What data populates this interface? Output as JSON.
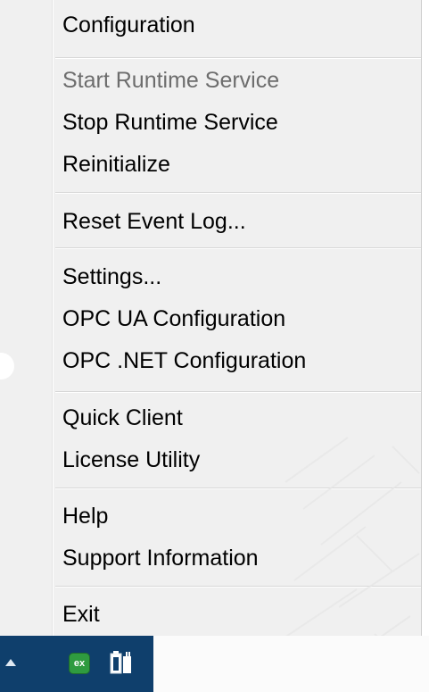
{
  "menu": {
    "items": [
      {
        "label": "Configuration",
        "enabled": true
      },
      {
        "label": "Start Runtime Service",
        "enabled": false
      },
      {
        "label": "Stop Runtime Service",
        "enabled": true
      },
      {
        "label": "Reinitialize",
        "enabled": true
      },
      {
        "label": "Reset Event Log...",
        "enabled": true
      },
      {
        "label": "Settings...",
        "enabled": true
      },
      {
        "label": "OPC UA Configuration",
        "enabled": true
      },
      {
        "label": "OPC .NET Configuration",
        "enabled": true
      },
      {
        "label": "Quick Client",
        "enabled": true
      },
      {
        "label": "License Utility",
        "enabled": true
      },
      {
        "label": "Help",
        "enabled": true
      },
      {
        "label": "Support Information",
        "enabled": true
      },
      {
        "label": "Exit",
        "enabled": true
      }
    ]
  },
  "taskbar": {
    "ex_icon_label": "ex",
    "icons": [
      "show-hidden-icons-arrow-icon",
      "kepserver-ex-tray-icon",
      "power-battery-tray-icon"
    ]
  },
  "colors": {
    "menu_bg": "#f0f0f0",
    "disabled_text": "#6d6d6d",
    "taskbar_bg": "#0f3f6c",
    "ex_icon_green": "#2f9b3f"
  }
}
